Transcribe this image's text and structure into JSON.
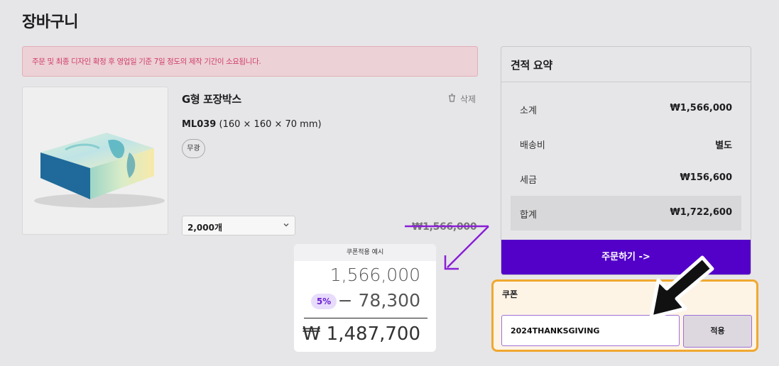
{
  "page": {
    "title": "장바구니"
  },
  "notice": {
    "text": "주문 및 최종 디자인 확정 후 영업일 기준 7일 정도의 제작 기간이 소요됩니다."
  },
  "cart_item": {
    "name": "G형 포장박스",
    "delete_label": "삭제",
    "code": "ML039",
    "dimensions": "(160 × 160 × 70 mm)",
    "finish": "무광",
    "quantity": "2,000개",
    "original_price": "₩1,566,000"
  },
  "summary": {
    "title": "견적 요약",
    "rows": [
      {
        "label": "소계",
        "value": "₩1,566,000"
      },
      {
        "label": "배송비",
        "value": "별도"
      },
      {
        "label": "세금",
        "value": "₩156,600"
      },
      {
        "label": "합계",
        "value": "₩1,722,600"
      }
    ],
    "order_button": "주문하기 ->"
  },
  "coupon": {
    "label": "쿠폰",
    "input_value": "2024THANKSGIVING",
    "apply_button": "적용"
  },
  "coupon_example": {
    "title": "쿠폰적용 예시",
    "subtotal": "1,566,000",
    "discount_rate": "5%",
    "discount": "− 78,300",
    "final": "₩ 1,487,700"
  },
  "colors": {
    "accent": "#5300c9",
    "annotation_arrow": "#8a1fd6",
    "coupon_highlight": "#f0a830",
    "notice_text": "#cf3f6a"
  }
}
